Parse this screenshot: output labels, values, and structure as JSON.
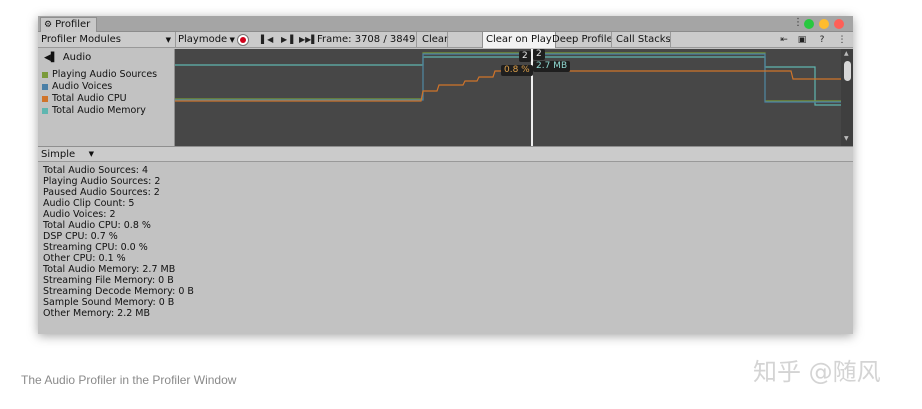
{
  "window": {
    "tab_title": "Profiler",
    "kebab": "⋮"
  },
  "toolbar": {
    "modules_label": "Profiler Modules",
    "playmode_label": "Playmode",
    "frame_label": "Frame: 3708 / 3849",
    "clear_label": "Clear",
    "clear_on_play_label": "Clear on Play",
    "deep_profile_label": "Deep Profile",
    "call_stacks_label": "Call Stacks"
  },
  "module": {
    "name": "Audio",
    "legend": [
      {
        "label": "Playing Audio Sources",
        "color": "#7a9a3a"
      },
      {
        "label": "Audio Voices",
        "color": "#4a7fa6"
      },
      {
        "label": "Total Audio CPU",
        "color": "#d0742a"
      },
      {
        "label": "Total Audio Memory",
        "color": "#5fb6b0"
      }
    ]
  },
  "chart_tooltips": {
    "playing_sources": "2",
    "voices": "2",
    "cpu": "0.8 %",
    "memory": "2.7 MB"
  },
  "chart_data": {
    "type": "line",
    "series": [
      {
        "name": "Playing Audio Sources",
        "color": "#7a9a3a"
      },
      {
        "name": "Audio Voices",
        "color": "#4a7fa6"
      },
      {
        "name": "Total Audio CPU",
        "color": "#d0742a"
      },
      {
        "name": "Total Audio Memory",
        "color": "#5fb6b0"
      }
    ],
    "selected_frame": 3708
  },
  "detail": {
    "view_label": "Simple",
    "stats": [
      "Total Audio Sources: 4",
      "Playing Audio Sources: 2",
      "Paused Audio Sources: 2",
      "Audio Clip Count: 5",
      "Audio Voices: 2",
      "Total Audio CPU: 0.8 %",
      "DSP CPU: 0.7 %",
      "Streaming CPU: 0.0 %",
      "Other CPU: 0.1 %",
      "Total Audio Memory: 2.7 MB",
      "Streaming File Memory: 0 B",
      "Streaming Decode Memory: 0 B",
      "Sample Sound Memory: 0 B",
      "Other Memory: 2.2 MB"
    ]
  },
  "caption": "The Audio Profiler in the Profiler Window",
  "watermark": "知乎 @随风"
}
